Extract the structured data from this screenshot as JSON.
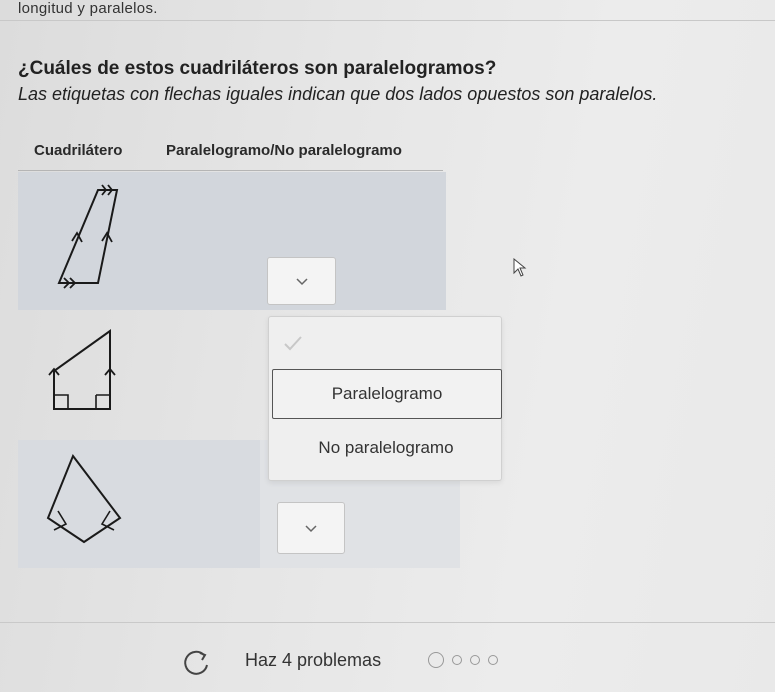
{
  "header": {
    "top_text": "longitud y paralelos.",
    "question": "¿Cuáles de estos cuadriláteros son paralelogramos?",
    "subtitle": "Las etiquetas con flechas iguales indican que dos lados opuestos son paralelos."
  },
  "table": {
    "col1": "Cuadrilátero",
    "col2": "Paralelogramo/No paralelogramo",
    "rows": [
      {
        "shape": "parallelogram-with-arrows"
      },
      {
        "shape": "trapezoid-right-angles"
      },
      {
        "shape": "kite"
      }
    ]
  },
  "dropdown_menu": {
    "options": [
      "Paralelogramo",
      "No paralelogramo"
    ],
    "highlighted": "Paralelogramo"
  },
  "footer": {
    "text": "Haz 4 problemas"
  }
}
